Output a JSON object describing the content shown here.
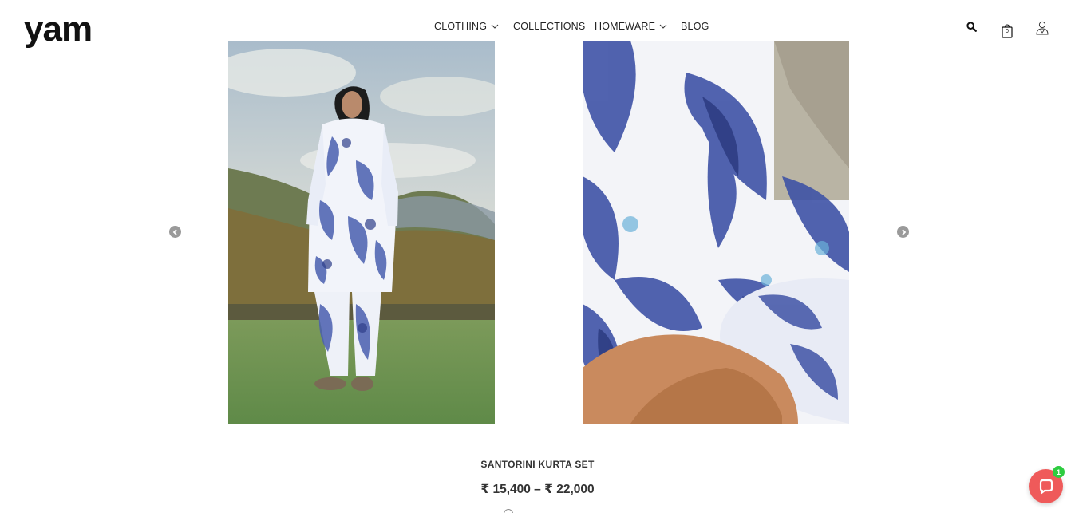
{
  "brand": {
    "name": "yam"
  },
  "nav": {
    "items": [
      {
        "label": "CLOTHING",
        "has_dropdown": true
      },
      {
        "label": "COLLECTIONS",
        "has_dropdown": false
      },
      {
        "label": "HOMEWARE",
        "has_dropdown": true
      },
      {
        "label": "BLOG",
        "has_dropdown": false
      }
    ]
  },
  "header_icons": [
    "search-icon",
    "shopping-bag-icon",
    "account-icon"
  ],
  "cart": {
    "count": "0"
  },
  "gallery": {
    "images": [
      {
        "name": "model-full-outfit-image"
      },
      {
        "name": "sleeve-print-closeup-image"
      }
    ],
    "prev_icon": "chevron-left-icon",
    "next_icon": "chevron-right-icon"
  },
  "product": {
    "title": "SANTORINI KURTA SET",
    "price_range": "₹ 15,400 – ₹ 22,000"
  },
  "chat_widget": {
    "icon": "chat-bubble-icon",
    "badge": "1",
    "color": "#ef5a5a",
    "badge_color": "#2ecc40"
  }
}
